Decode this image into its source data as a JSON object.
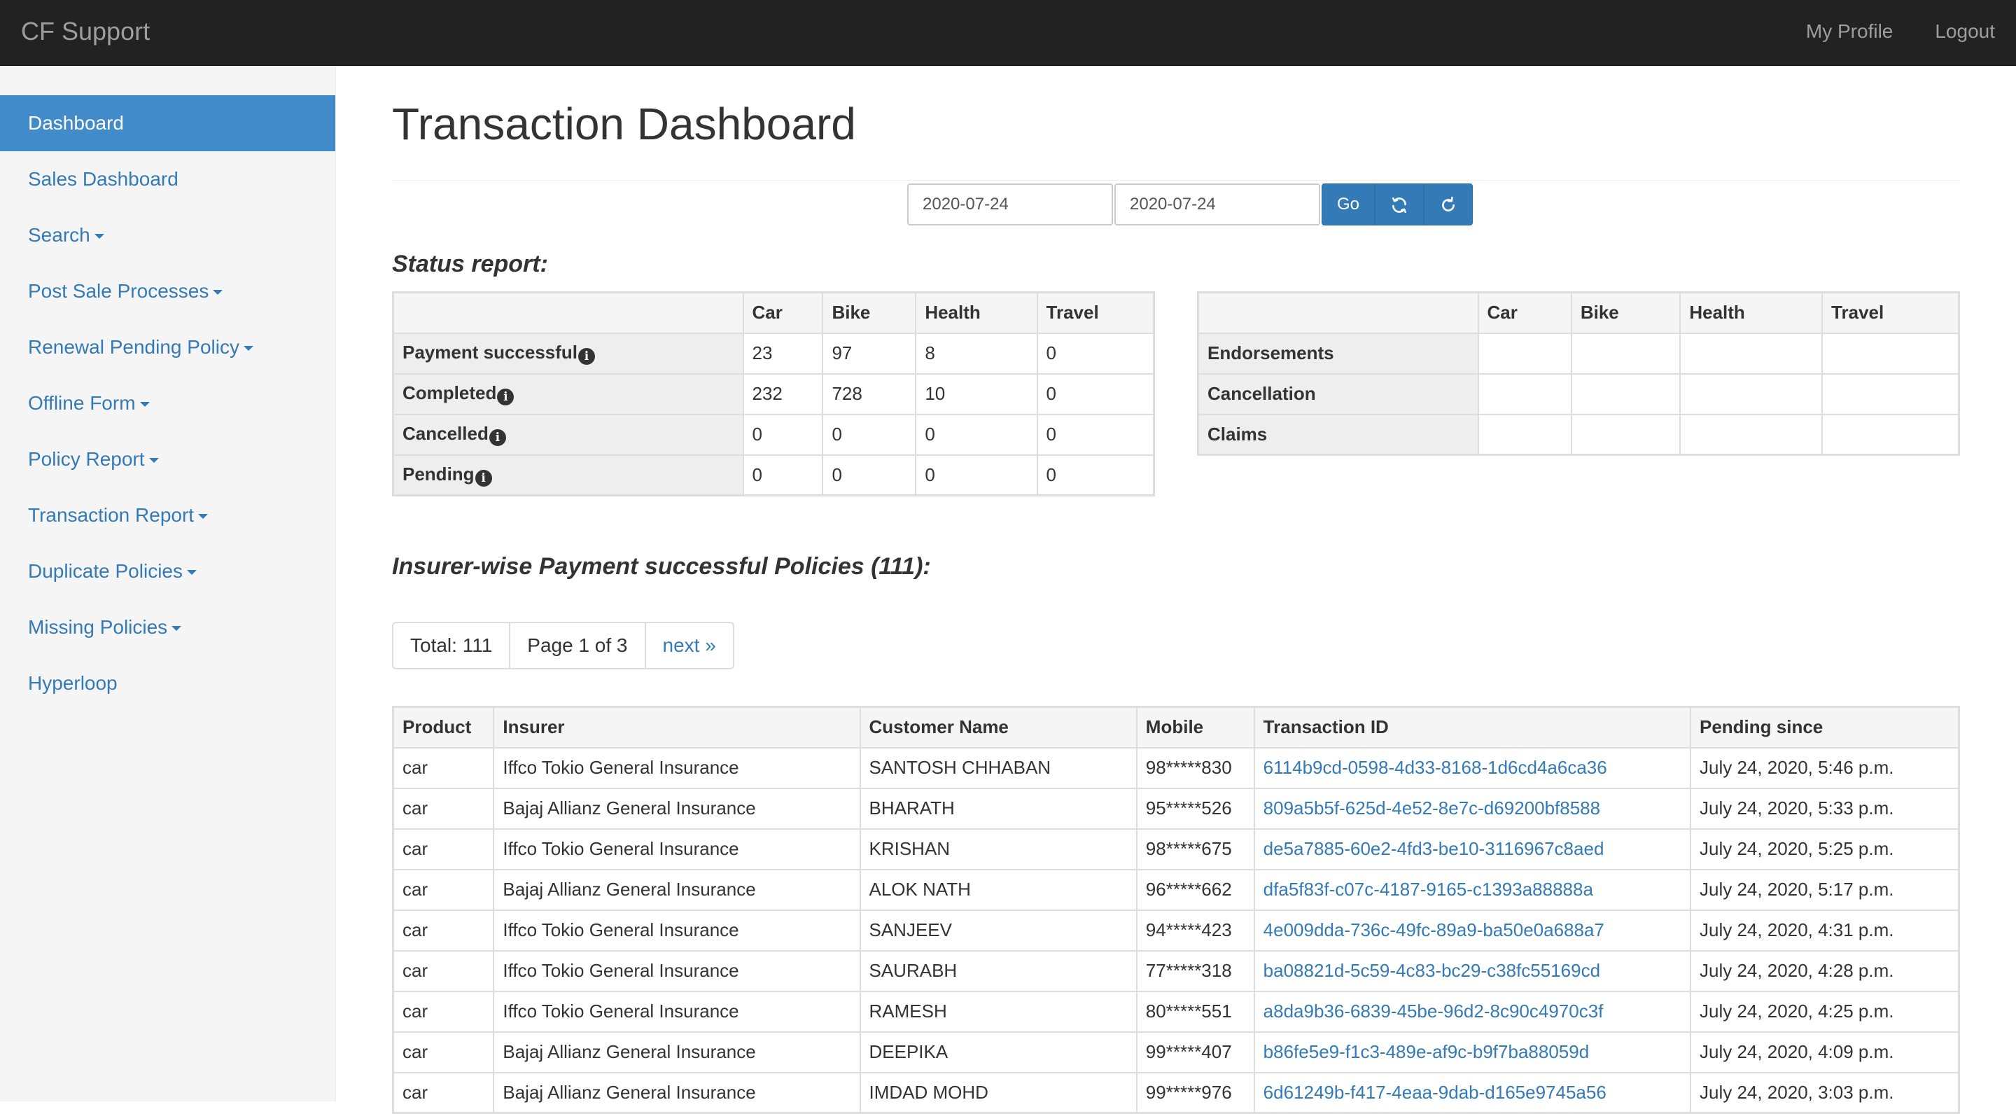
{
  "navbar": {
    "brand": "CF Support",
    "links": [
      "My Profile",
      "Logout"
    ]
  },
  "sidebar": {
    "items": [
      {
        "label": "Dashboard",
        "active": true,
        "dropdown": false
      },
      {
        "label": "Sales Dashboard",
        "active": false,
        "dropdown": false
      },
      {
        "label": "Search",
        "active": false,
        "dropdown": true
      },
      {
        "label": "Post Sale Processes",
        "active": false,
        "dropdown": true
      },
      {
        "label": "Renewal Pending Policy",
        "active": false,
        "dropdown": true
      },
      {
        "label": "Offline Form",
        "active": false,
        "dropdown": true
      },
      {
        "label": "Policy Report",
        "active": false,
        "dropdown": true
      },
      {
        "label": "Transaction Report",
        "active": false,
        "dropdown": true
      },
      {
        "label": "Duplicate Policies",
        "active": false,
        "dropdown": true
      },
      {
        "label": "Missing Policies",
        "active": false,
        "dropdown": true
      },
      {
        "label": "Hyperloop",
        "active": false,
        "dropdown": false
      }
    ]
  },
  "main": {
    "title": "Transaction Dashboard",
    "filter": {
      "from_date": "2020-07-24",
      "to_date": "2020-07-24",
      "go_label": "Go"
    },
    "status_title": "Status report:",
    "status_table": {
      "columns": [
        "",
        "Car",
        "Bike",
        "Health",
        "Travel"
      ],
      "rows": [
        {
          "label": "Payment successful",
          "values": [
            "23",
            "97",
            "8",
            "0"
          ]
        },
        {
          "label": "Completed",
          "values": [
            "232",
            "728",
            "10",
            "0"
          ]
        },
        {
          "label": "Cancelled",
          "values": [
            "0",
            "0",
            "0",
            "0"
          ]
        },
        {
          "label": "Pending",
          "values": [
            "0",
            "0",
            "0",
            "0"
          ]
        }
      ]
    },
    "post_sale_table": {
      "columns": [
        "",
        "Car",
        "Bike",
        "Health",
        "Travel"
      ],
      "rows": [
        {
          "label": "Endorsements",
          "values": [
            "",
            "",
            "",
            ""
          ]
        },
        {
          "label": "Cancellation",
          "values": [
            "",
            "",
            "",
            ""
          ]
        },
        {
          "label": "Claims",
          "values": [
            "",
            "",
            "",
            ""
          ]
        }
      ]
    },
    "insurer_title": "Insurer-wise Payment successful Policies (111):",
    "pager": {
      "total": "Total: 111",
      "page": "Page 1 of 3",
      "next": "next »"
    },
    "policies": {
      "columns": [
        "Product",
        "Insurer",
        "Customer Name",
        "Mobile",
        "Transaction ID",
        "Pending since"
      ],
      "rows": [
        [
          "car",
          "Iffco Tokio General Insurance",
          "SANTOSH CHHABAN",
          "98*****830",
          "6114b9cd-0598-4d33-8168-1d6cd4a6ca36",
          "July 24, 2020, 5:46 p.m."
        ],
        [
          "car",
          "Bajaj Allianz General Insurance",
          "BHARATH",
          "95*****526",
          "809a5b5f-625d-4e52-8e7c-d69200bf8588",
          "July 24, 2020, 5:33 p.m."
        ],
        [
          "car",
          "Iffco Tokio General Insurance",
          "KRISHAN",
          "98*****675",
          "de5a7885-60e2-4fd3-be10-3116967c8aed",
          "July 24, 2020, 5:25 p.m."
        ],
        [
          "car",
          "Bajaj Allianz General Insurance",
          "ALOK NATH",
          "96*****662",
          "dfa5f83f-c07c-4187-9165-c1393a88888a",
          "July 24, 2020, 5:17 p.m."
        ],
        [
          "car",
          "Iffco Tokio General Insurance",
          "SANJEEV",
          "94*****423",
          "4e009dda-736c-49fc-89a9-ba50e0a688a7",
          "July 24, 2020, 4:31 p.m."
        ],
        [
          "car",
          "Iffco Tokio General Insurance",
          "SAURABH",
          "77*****318",
          "ba08821d-5c59-4c83-bc29-c38fc55169cd",
          "July 24, 2020, 4:28 p.m."
        ],
        [
          "car",
          "Iffco Tokio General Insurance",
          "RAMESH",
          "80*****551",
          "a8da9b36-6839-45be-96d2-8c90c4970c3f",
          "July 24, 2020, 4:25 p.m."
        ],
        [
          "car",
          "Bajaj Allianz General Insurance",
          "DEEPIKA",
          "99*****407",
          "b86fe5e9-f1c3-489e-af9c-b9f7ba88059d",
          "July 24, 2020, 4:09 p.m."
        ],
        [
          "car",
          "Bajaj Allianz General Insurance",
          "IMDAD MOHD",
          "99*****976",
          "6d61249b-f417-4eaa-9dab-d165e9745a56",
          "July 24, 2020, 3:03 p.m."
        ]
      ]
    }
  },
  "colors": {
    "navbar_bg": "#222222",
    "accent": "#337ab7",
    "active_item_bg": "#428bca",
    "sidebar_bg": "#f5f5f5"
  },
  "icons": {
    "sync": "sync-icon",
    "refresh": "refresh-icon",
    "info": "info-icon"
  }
}
